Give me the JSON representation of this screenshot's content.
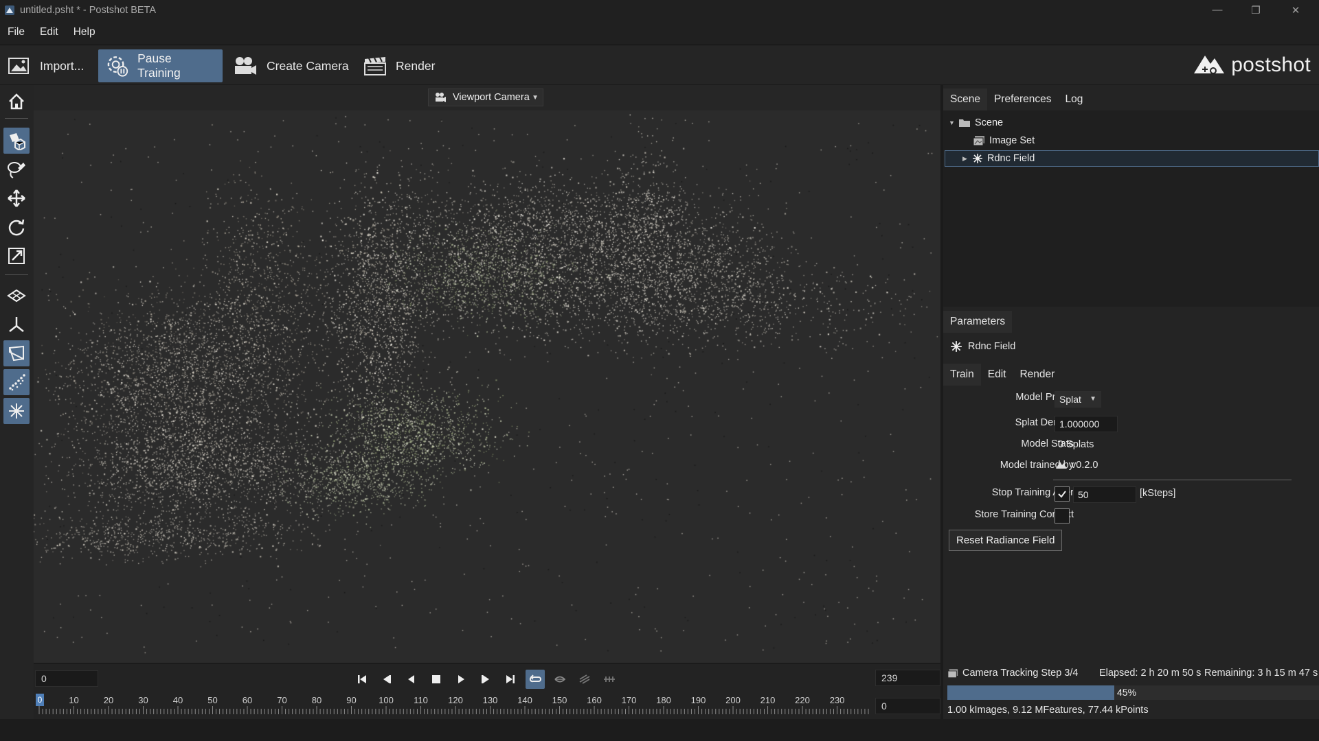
{
  "window": {
    "title": "untitled.psht * - Postshot BETA",
    "controls": {
      "minimize": "—",
      "maximize": "❐",
      "close": "✕"
    }
  },
  "menu": [
    "File",
    "Edit",
    "Help"
  ],
  "toolbar": {
    "import_label": "Import...",
    "pause_label": "Pause Training",
    "create_camera_label": "Create Camera",
    "render_label": "Render",
    "logo_text": "postshot"
  },
  "tools": [
    {
      "icon": "home-icon"
    },
    {
      "icon": "select-icon",
      "active": true
    },
    {
      "icon": "lasso-icon"
    },
    {
      "icon": "move-icon"
    },
    {
      "icon": "rotate-icon"
    },
    {
      "icon": "scale-icon"
    },
    {
      "icon": "layers-icon"
    },
    {
      "icon": "axis-icon"
    },
    {
      "icon": "camera-frustum-icon",
      "active": true
    },
    {
      "icon": "points-icon",
      "active": true
    },
    {
      "icon": "splat-icon",
      "active": true
    }
  ],
  "viewport": {
    "camera_select": "Viewport Camera"
  },
  "timeline": {
    "start_frame": "0",
    "end_frame": "239",
    "current_frame": "0",
    "playhead": "0",
    "ticks": [
      "10",
      "20",
      "30",
      "40",
      "50",
      "60",
      "70",
      "80",
      "90",
      "100",
      "110",
      "120",
      "130",
      "140",
      "150",
      "160",
      "170",
      "180",
      "190",
      "200",
      "210",
      "220",
      "230"
    ]
  },
  "scene_panel": {
    "tabs": [
      "Scene",
      "Preferences",
      "Log"
    ],
    "tree": {
      "root": "Scene",
      "image_set": "Image Set",
      "field": "Rdnc Field"
    }
  },
  "params": {
    "tab": "Parameters",
    "object": "Rdnc Field",
    "sub_tabs": [
      "Train",
      "Edit",
      "Render"
    ],
    "model_profile_label": "Model Profile",
    "model_profile_value": "Splat",
    "splat_density_label": "Splat Density",
    "splat_density_value": "1.000000",
    "model_stats_label": "Model Stats",
    "model_stats_value": "0 Splats",
    "trained_by_label": "Model trained by",
    "trained_by_value": "v0.2.0",
    "stop_training_label": "Stop Training After",
    "stop_training_checked": true,
    "stop_training_value": "50",
    "stop_training_unit": "[kSteps]",
    "store_context_label": "Store Training Context",
    "store_context_checked": false,
    "reset_button": "Reset Radiance Field"
  },
  "status": {
    "step": "Camera Tracking Step 3/4",
    "elapsed": "Elapsed: 2 h 20 m 50 s",
    "remaining": "Remaining: 3 h 15 m 47 s",
    "progress_percent": 45,
    "progress_label": "45%",
    "stats": "1.00 kImages, 9.12 MFeatures, 77.44 kPoints"
  },
  "colors": {
    "accent": "#4f6c8c",
    "background": "#1b1b1b",
    "panel": "#242424",
    "viewport": "#2b2b2b"
  }
}
